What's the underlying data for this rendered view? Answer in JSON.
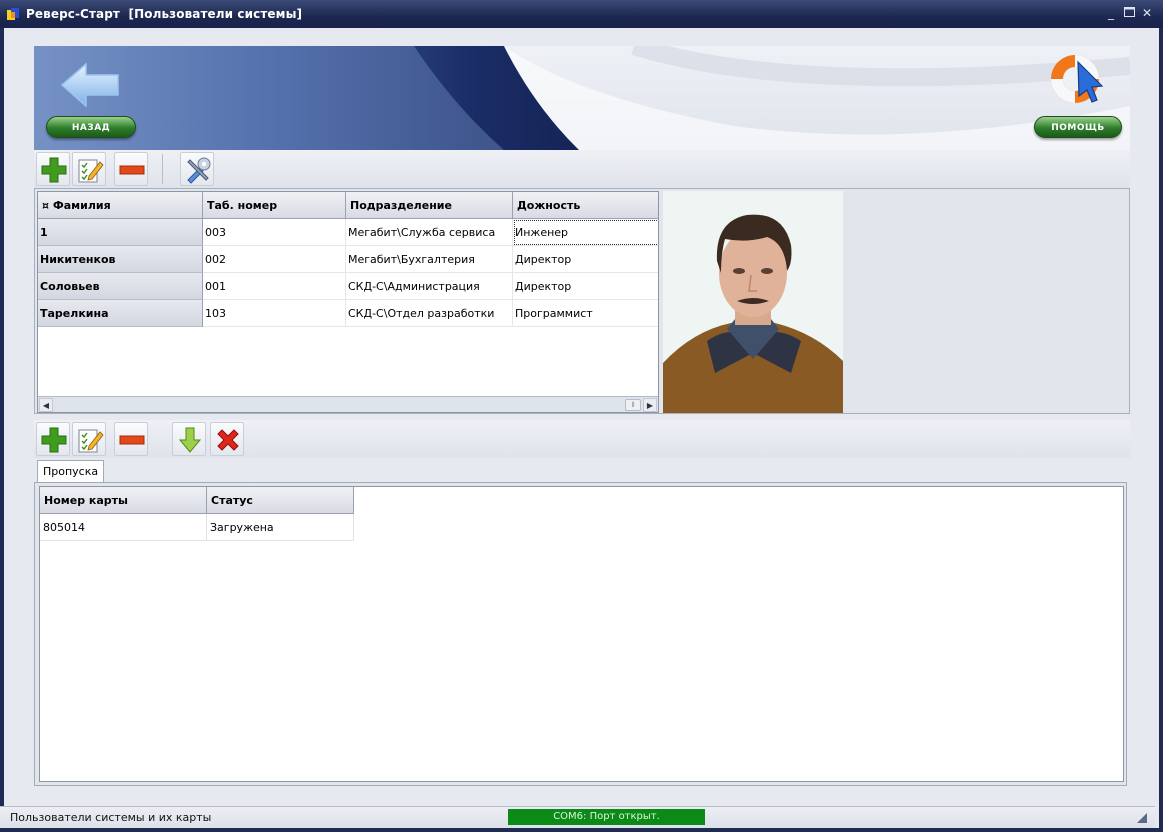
{
  "window": {
    "title": "Реверс-Старт  [Пользователи системы]"
  },
  "header": {
    "back_label": "НАЗАД",
    "help_label": "ПОМОЩЬ"
  },
  "toolbar_top": {
    "icons": [
      "plus-icon",
      "edit-icon",
      "minus-icon",
      "tools-icon"
    ]
  },
  "users_grid": {
    "columns": [
      "¤ Фамилия",
      "Таб. номер",
      "Подразделение",
      "Дожность"
    ],
    "rows": [
      [
        "1",
        "003",
        "Мегабит\\Служба сервиса",
        "Инженер"
      ],
      [
        "Никитенков",
        "002",
        "Мегабит\\Бухгалтерия",
        "Директор"
      ],
      [
        "Соловьев",
        "001",
        "СКД-С\\Администрация",
        "Директор"
      ],
      [
        "Тарелкина",
        "103",
        "СКД-С\\Отдел разработки",
        "Программист"
      ]
    ]
  },
  "toolbar_bottom": {
    "icons": [
      "plus-icon",
      "edit-icon",
      "minus-icon",
      "download-icon",
      "delete-icon"
    ]
  },
  "tabs": [
    {
      "label": "Пропуска"
    }
  ],
  "cards_grid": {
    "columns": [
      "Номер карты",
      "Статус"
    ],
    "rows": [
      [
        "805014",
        "Загружена"
      ]
    ]
  },
  "statusbar": {
    "text": "Пользователи системы и их карты",
    "port": "COM6: Порт открыт."
  },
  "colors": {
    "title_bar": "#1d2850",
    "port_ok": "#0c8a17",
    "accent_blue": "#2a3e78"
  }
}
